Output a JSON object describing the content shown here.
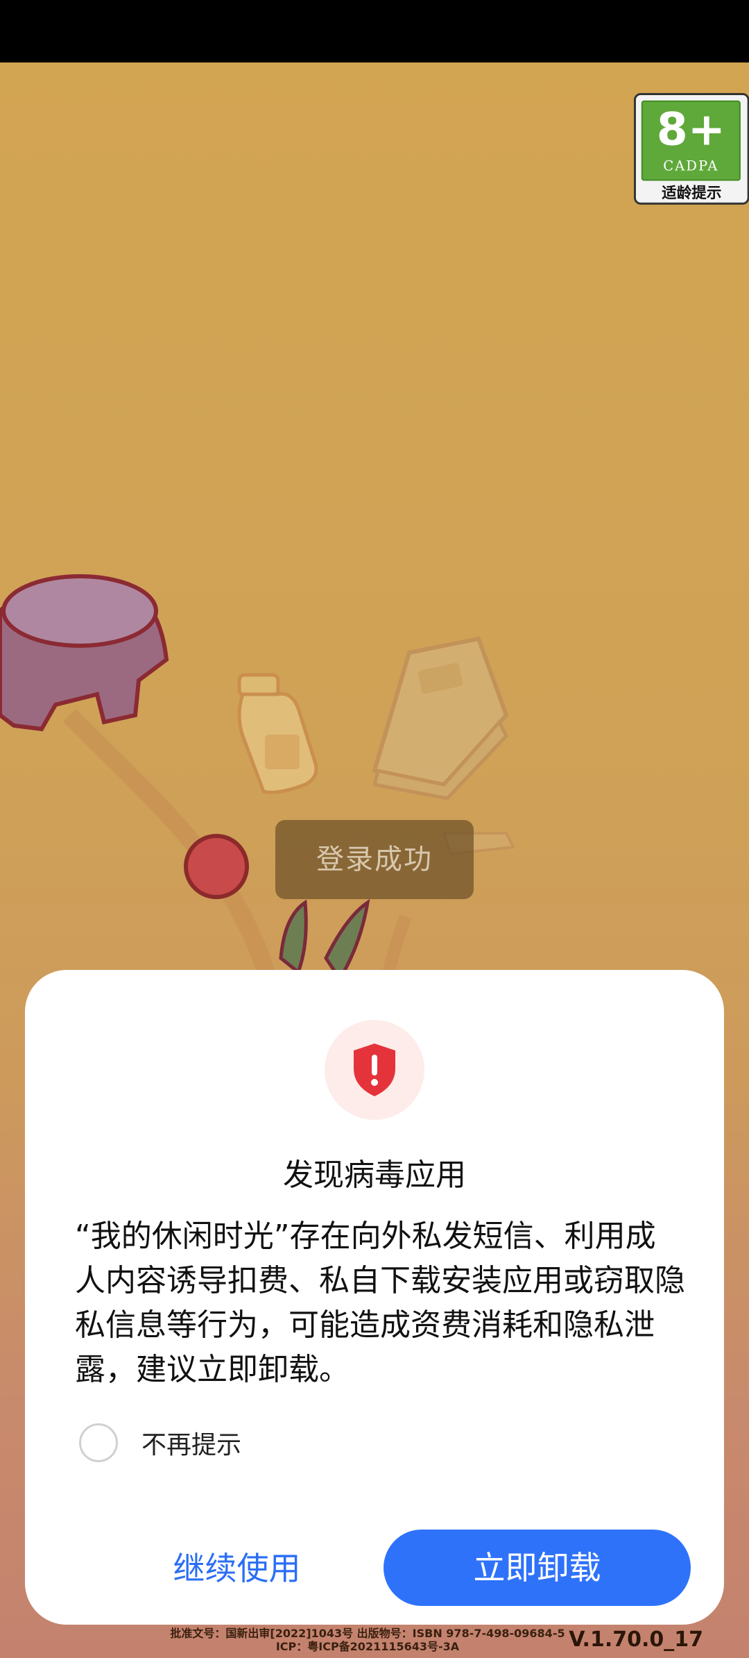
{
  "age_badge": {
    "rating": "8+",
    "org": "CADPA",
    "caption": "适龄提示"
  },
  "toast": {
    "text": "登录成功"
  },
  "dialog": {
    "icon": "shield-alert-icon",
    "title": "发现病毒应用",
    "message": "“我的休闲时光”存在向外私发短信、利用成人内容诱导扣费、私自下载安装应用或窃取隐私信息等行为，可能造成资费消耗和隐私泄露，建议立即卸载。",
    "checkbox_label": "不再提示",
    "checkbox_checked": false,
    "continue_label": "继续使用",
    "uninstall_label": "立即卸载"
  },
  "footer": {
    "approval_line": "批准文号：国新出审[2022]1043号   出版物号：ISBN 978-7-498-09684-5",
    "icp_line": "ICP：粤ICP备2021115643号-3A",
    "version": "V.1.70.0_17"
  },
  "colors": {
    "accent": "#2f72fa",
    "warning": "#e5333b",
    "badge_green": "#5fa83a"
  }
}
